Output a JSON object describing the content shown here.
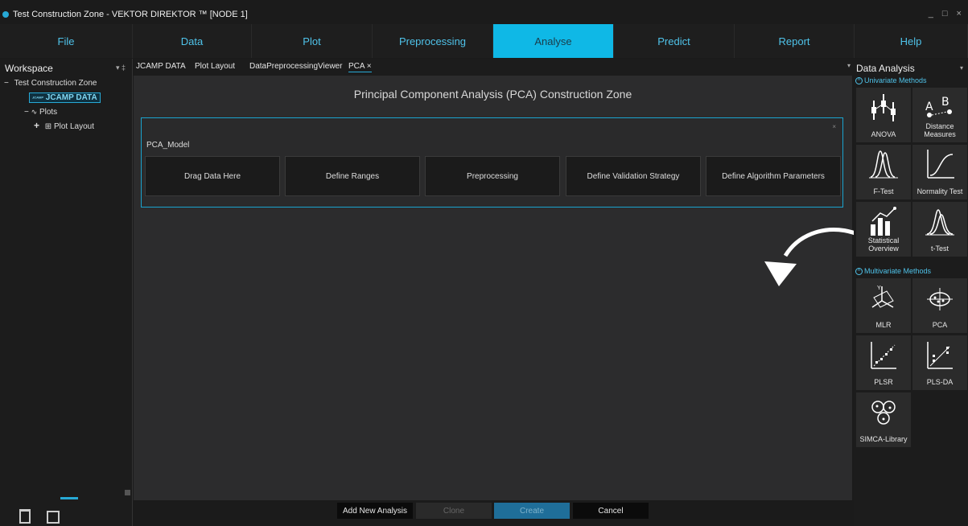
{
  "window": {
    "title": "Test Construction Zone - VEKTOR DIREKTOR ™ [NODE 1]",
    "controls": "_ □ ×"
  },
  "menu": [
    "File",
    "Data",
    "Plot",
    "Preprocessing",
    "Analyse",
    "Predict",
    "Report",
    "Help"
  ],
  "menu_active": "Analyse",
  "workspace": {
    "title": "Workspace",
    "pin": "▾ ‡",
    "tree": {
      "root": "Test Construction Zone",
      "jcamp_badge": "JCAMP",
      "jcamp": "JCAMP DATA",
      "plots": "Plots",
      "plot_layout": "Plot Layout"
    }
  },
  "tabs": [
    "JCAMP DATA",
    "Plot Layout",
    "DataPreprocessingViewer",
    "PCA ×"
  ],
  "tab_menu": "▾",
  "main": {
    "heading": "Principal Component Analysis (PCA) Construction Zone",
    "model_name": "PCA_Model",
    "close": "×",
    "steps": [
      "Drag Data Here",
      "Define Ranges",
      "Preprocessing",
      "Define Validation Strategy",
      "Define Algorithm Parameters"
    ]
  },
  "footer": {
    "add_new": "Add New Analysis",
    "clone": "Clone",
    "create": "Create",
    "cancel": "Cancel"
  },
  "data_analysis": {
    "title": "Data Analysis",
    "menu": "▾",
    "univariate": "Univariate Methods",
    "multivariate": "Multivariate Methods",
    "collapse_glyph": "˄",
    "tools": {
      "anova": "ANOVA",
      "distance": "Distance Measures",
      "ftest": "F-Test",
      "normality": "Normality Test",
      "statistical": "Statistical Overview",
      "ttest": "t-Test",
      "mlr": "MLR",
      "pca": "PCA",
      "plsr": "PLSR",
      "plsda": "PLS-DA",
      "simca": "SIMCA-Library"
    }
  },
  "colors": {
    "accent": "#0fb8e6",
    "create_button": "#1f6e99"
  }
}
